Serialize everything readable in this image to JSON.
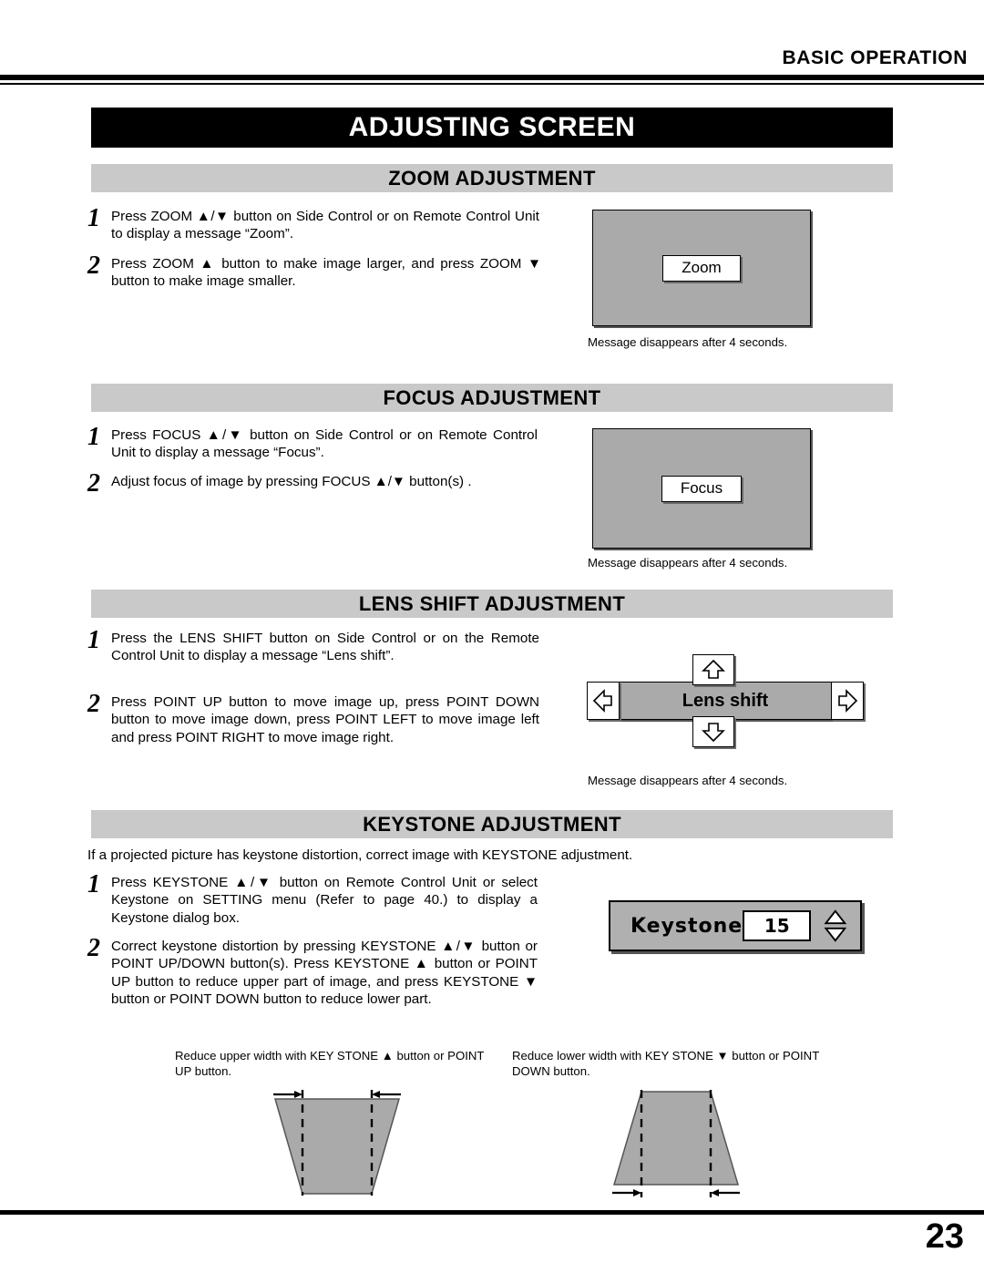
{
  "header": {
    "running_head": "BASIC OPERATION"
  },
  "page_title": "ADJUSTING SCREEN",
  "sections": [
    {
      "id": "zoom",
      "heading": "ZOOM ADJUSTMENT",
      "steps": [
        {
          "num": "1",
          "text": "Press ZOOM ▲/▼ button on Side Control or on Remote Control Unit to display a message “Zoom”."
        },
        {
          "num": "2",
          "text": "Press ZOOM ▲ button to make image larger, and press ZOOM ▼ button to make image smaller."
        }
      ],
      "osd": {
        "chip_label": "Zoom",
        "caption": "Message disappears after 4 seconds."
      }
    },
    {
      "id": "focus",
      "heading": "FOCUS ADJUSTMENT",
      "steps": [
        {
          "num": "1",
          "text": "Press FOCUS ▲/▼ button on Side Control or on Remote Control Unit to display a message “Focus”."
        },
        {
          "num": "2",
          "text": "Adjust focus of image by pressing FOCUS ▲/▼  button(s) ."
        }
      ],
      "osd": {
        "chip_label": "Focus",
        "caption": "Message disappears after 4 seconds."
      }
    },
    {
      "id": "lens-shift",
      "heading": "LENS SHIFT ADJUSTMENT",
      "steps": [
        {
          "num": "1",
          "text": "Press the LENS SHIFT button on Side Control or on the Remote Control Unit to display a message “Lens shift”."
        },
        {
          "num": "2",
          "text": "Press POINT UP button to move image up, press POINT DOWN button to move image down, press POINT LEFT to move image left and press POINT RIGHT to move image right."
        }
      ],
      "osd": {
        "chip_label": "Lens shift",
        "caption": "Message disappears after 4 seconds."
      }
    },
    {
      "id": "keystone",
      "heading": "KEYSTONE ADJUSTMENT",
      "intro": "If a projected picture has keystone distortion, correct image with KEYSTONE adjustment.",
      "steps": [
        {
          "num": "1",
          "text": "Press KEYSTONE ▲/▼ button on Remote Control Unit or select Keystone on SETTING menu (Refer to page 40.) to display a Keystone dialog box."
        },
        {
          "num": "2",
          "text": "Correct keystone distortion by pressing KEYSTONE ▲/▼ button or POINT UP/DOWN button(s).  Press KEYSTONE ▲ button or POINT UP button to reduce upper part of image, and press KEYSTONE ▼ button or POINT DOWN button to reduce lower part."
        }
      ],
      "dialog": {
        "label": "Keystone",
        "value": "15"
      },
      "figures": [
        {
          "caption": "Reduce upper width with KEY STONE ▲ button or POINT UP button."
        },
        {
          "caption": "Reduce lower width with KEY STONE ▼ button or POINT DOWN button."
        }
      ]
    }
  ],
  "footer": {
    "page_number": "23"
  },
  "colors": {
    "title_bar": "#000000",
    "section_bar": "#c9c9c9",
    "osd_screen": "#aaaaaa",
    "dialog": "#b0b0b0"
  }
}
